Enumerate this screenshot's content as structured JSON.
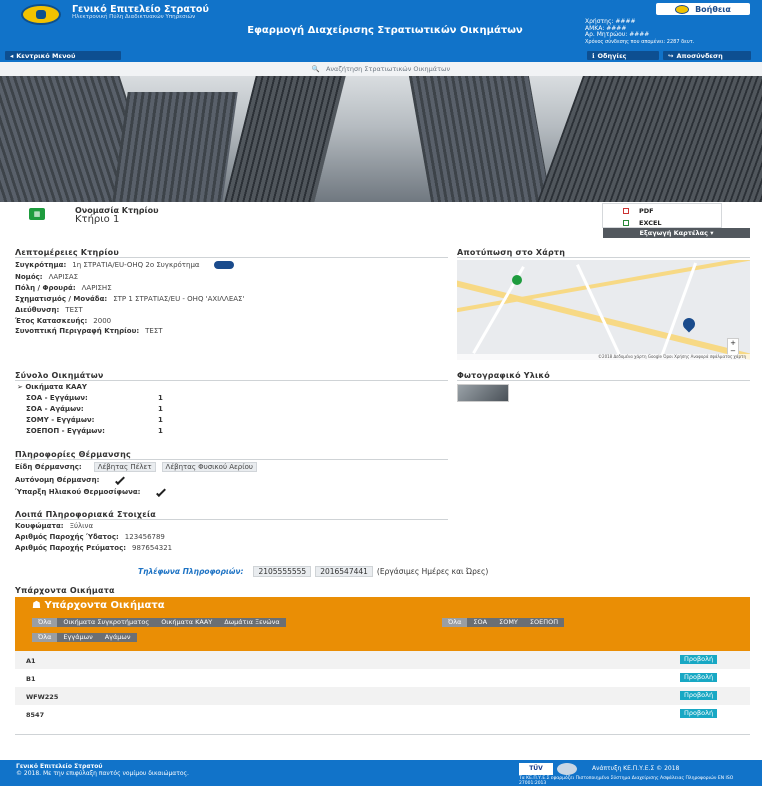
{
  "header": {
    "org_title": "Γενικό Επιτελείο Στρατού",
    "org_subtitle": "Ηλεκτρονική Πύλη Διαδικτυακών Υπηρεσιών",
    "app_title": "Εφαρμογή Διαχείρισης Στρατιωτικών Οικημάτων",
    "help_label": "Βοήθεια",
    "user_line1": "Χρήστης: ####",
    "user_line2": "ΑΜΚΑ: ####",
    "user_line3": "Αρ. Μητρώου: ####",
    "user_line4": "Χρόνος σύνδεσης που απομένει: 2287 δευτ.",
    "back_label": "Κεντρικό Μενού",
    "guide_label": "Οδηγίες",
    "logout_label": "Αποσύνδεση"
  },
  "search": {
    "label": "Αναζήτηση Στρατιωτικών Οικημάτων"
  },
  "building": {
    "name_label": "Ονομασία Κτηρίου",
    "name_value": "Κτήριο 1"
  },
  "export": {
    "pdf": "PDF",
    "excel": "EXCEL",
    "button": "Εξαγωγή Καρτέλας"
  },
  "details": {
    "title": "Λεπτομέρειες Κτηρίου",
    "fields": [
      {
        "label": "Συγκρότημα:",
        "value": "1η ΣΤΡΑΤΙΑ/EU-OHQ 2ο Συγκρότημα"
      },
      {
        "label": "Νομός:",
        "value": "ΛΑΡΙΣΑΣ"
      },
      {
        "label": "Πόλη / Φρουρά:",
        "value": "ΛΑΡΙΣΗΣ"
      },
      {
        "label": "Σχηματισμός / Μονάδα:",
        "value": "ΣΤΡ 1 ΣΤΡΑΤΙΑΣ/EU - OHQ 'ΑΧΙΛΛΕΑΣ'"
      },
      {
        "label": "Διεύθυνση:",
        "value": "ΤΕΣΤ"
      },
      {
        "label": "Έτος Κατασκευής:",
        "value": "2000"
      },
      {
        "label": "Συνοπτική Περιγραφή Κτηρίου:",
        "value": "ΤΕΣΤ"
      }
    ]
  },
  "map": {
    "title": "Αποτύπωση στο Χάρτη",
    "footer": "©2018 Δεδομένα χάρτη Google   Όροι Χρήσης   Αναφορά σφάλματος χάρτη"
  },
  "photos": {
    "title": "Φωτογραφικό Υλικό"
  },
  "totals": {
    "title": "Σύνολο Οικημάτων",
    "group": "Οικήματα ΚΑΑΥ",
    "rows": [
      {
        "label": "ΣΟΑ - Εγγάμων:",
        "value": "1"
      },
      {
        "label": "ΣΟΑ - Αγάμων:",
        "value": "1"
      },
      {
        "label": "ΣΟΜΥ - Εγγάμων:",
        "value": "1"
      },
      {
        "label": "ΣΟΕΠΟΠ - Εγγάμων:",
        "value": "1"
      }
    ]
  },
  "heating": {
    "title": "Πληροφορίες Θέρμανσης",
    "types_label": "Είδη Θέρμανσης:",
    "type1": "Λέβητας Πέλετ",
    "type2": "Λέβητας Φυσικού Αερίου",
    "autonomous_label": "Αυτόνομη Θέρμανση:",
    "solar_label": "Ύπαρξη Ηλιακού Θερμοσίφωνα:"
  },
  "other": {
    "title": "Λοιπά Πληροφοριακά Στοιχεία",
    "rows": [
      {
        "label": "Κουφώματα:",
        "value": "Ξύλινα"
      },
      {
        "label": "Αριθμός Παροχής Ύδατος:",
        "value": "123456789"
      },
      {
        "label": "Αριθμός Παροχής Ρεύματος:",
        "value": "987654321"
      }
    ]
  },
  "phone": {
    "label": "Τηλέφωνα Πληροφοριών:",
    "n1": "2105555555",
    "n2": "2016547441",
    "hours": "(Εργάσιμες Ημέρες και Ώρες)"
  },
  "existing": {
    "section_title": "Υπάρχοντα Οικήματα",
    "panel_title": "Υπάρχοντα Οικήματα",
    "filters1": [
      "Όλα",
      "Οικήματα Συγκροτήματος",
      "Οικήματα ΚΑΑΥ",
      "Δωμάτια Ξενώνα"
    ],
    "filters2": [
      "Όλα",
      "ΣΟΑ",
      "ΣΟΜΥ",
      "ΣΟΕΠΟΠ"
    ],
    "filters3": [
      "Όλα",
      "Εγγάμων",
      "Αγάμων"
    ],
    "rows": [
      "A1",
      "B1",
      "WFW225",
      "8547"
    ],
    "view_label": "Προβολή"
  },
  "footer": {
    "line1": "Γενικό Επιτελείο Στρατού",
    "line2": "© 2018. Με την επιφύλαξη παντός νομίμου δικαιώματος.",
    "tuv": "TÜV",
    "dev": "Ανάπτυξη ΚΕ.Π.Υ.Ε.Σ © 2018",
    "cert": "Τα ΚΕ.Π.Υ.Ε.Σ εφαρμόζει Πιστοποιημένο Σύστημα Διαχείρισης Ασφάλειας Πληροφοριών EN ISO 27001:2013"
  },
  "colors": {
    "primary": "#1173c9",
    "panel": "#ea8e05",
    "view_button": "#18a8c4"
  }
}
